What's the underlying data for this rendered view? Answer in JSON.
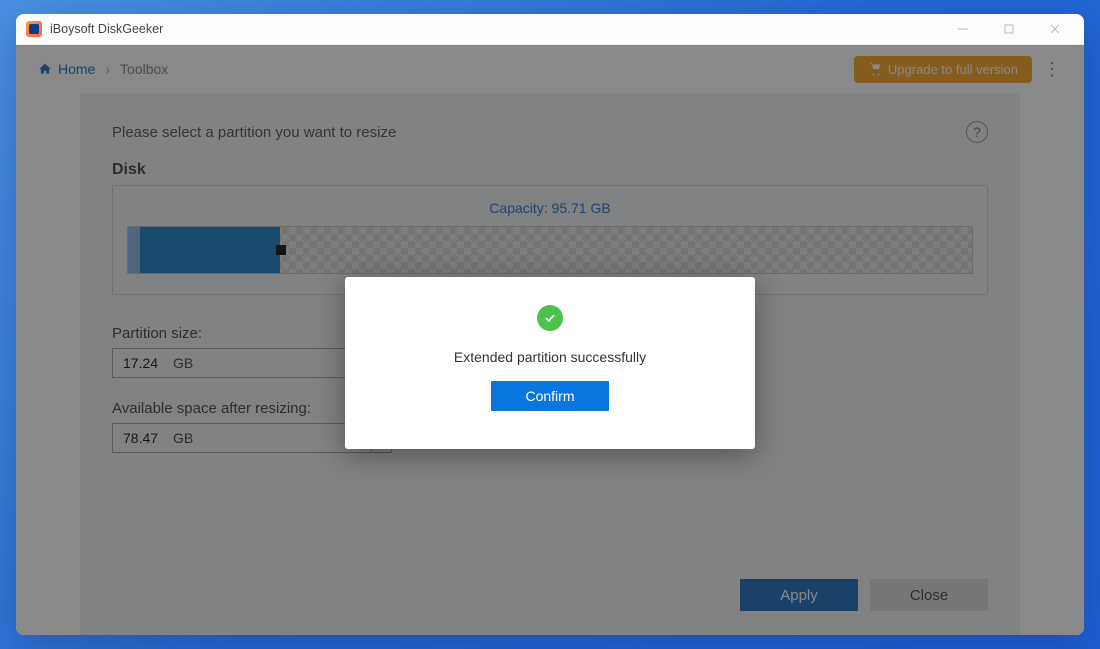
{
  "window": {
    "title": "iBoysoft DiskGeeker"
  },
  "topbar": {
    "home_label": "Home",
    "current_label": "Toolbox",
    "upgrade_label": "Upgrade to full version"
  },
  "panel": {
    "instruction": "Please select a partition you want to resize",
    "disk_label": "Disk",
    "capacity_label": "Capacity: 95.71 GB",
    "partition_size_label": "Partition size:",
    "partition_size_value": "17.24",
    "partition_size_unit": "GB",
    "available_label": "Available space after resizing:",
    "available_value": "78.47",
    "available_unit": "GB",
    "apply_label": "Apply",
    "close_label": "Close"
  },
  "modal": {
    "message": "Extended partition successfully",
    "confirm_label": "Confirm"
  },
  "colors": {
    "accent": "#0a76e0",
    "primary_btn": "#0b63b5",
    "upgrade": "#f39c12",
    "success": "#4cc24c"
  }
}
